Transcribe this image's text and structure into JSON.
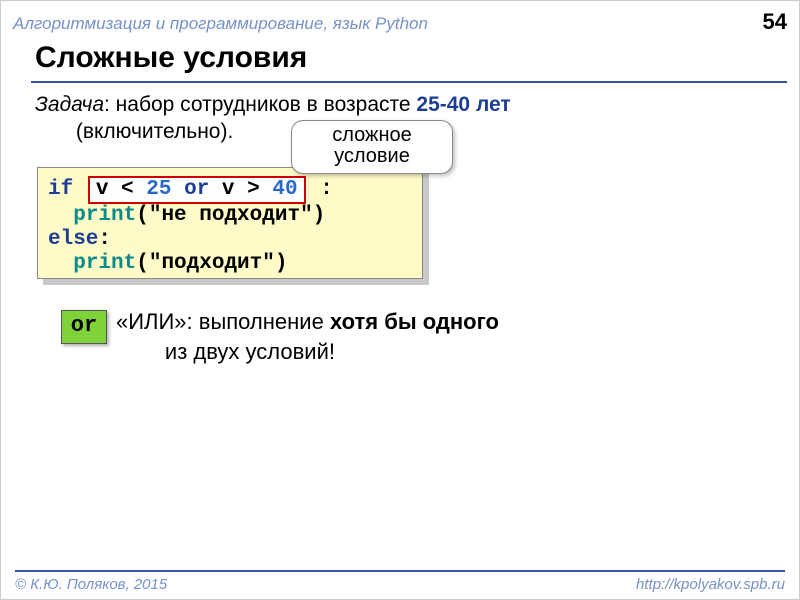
{
  "header": {
    "subject": "Алгоритмизация и программирование, язык Python",
    "page_number": "54"
  },
  "title": "Сложные условия",
  "task": {
    "label": "Задача",
    "text_before": ": набор сотрудников в возрасте ",
    "range": "25-40 лет",
    "text_after": " (включительно)."
  },
  "callout": {
    "line1": "сложное",
    "line2": "условие"
  },
  "code": {
    "if": "if",
    "cond": {
      "v1": "v",
      "lt": "<",
      "n1": "25",
      "or": "or",
      "v2": "v",
      "gt": ">",
      "n2": "40"
    },
    "colon": ":",
    "print1": "print",
    "paren_o": "(",
    "str1": "\"не подходит\"",
    "paren_c": ")",
    "else": "else",
    "print2": "print",
    "str2": "\"подходит\""
  },
  "or_badge": "or",
  "or_text": {
    "line1_a": "«ИЛИ»: выполнение ",
    "line1_b": "хотя бы одного",
    "line2": "из двух условий!"
  },
  "footer": {
    "left": "© К.Ю. Поляков, 2015",
    "right": "http://kpolyakov.spb.ru"
  }
}
